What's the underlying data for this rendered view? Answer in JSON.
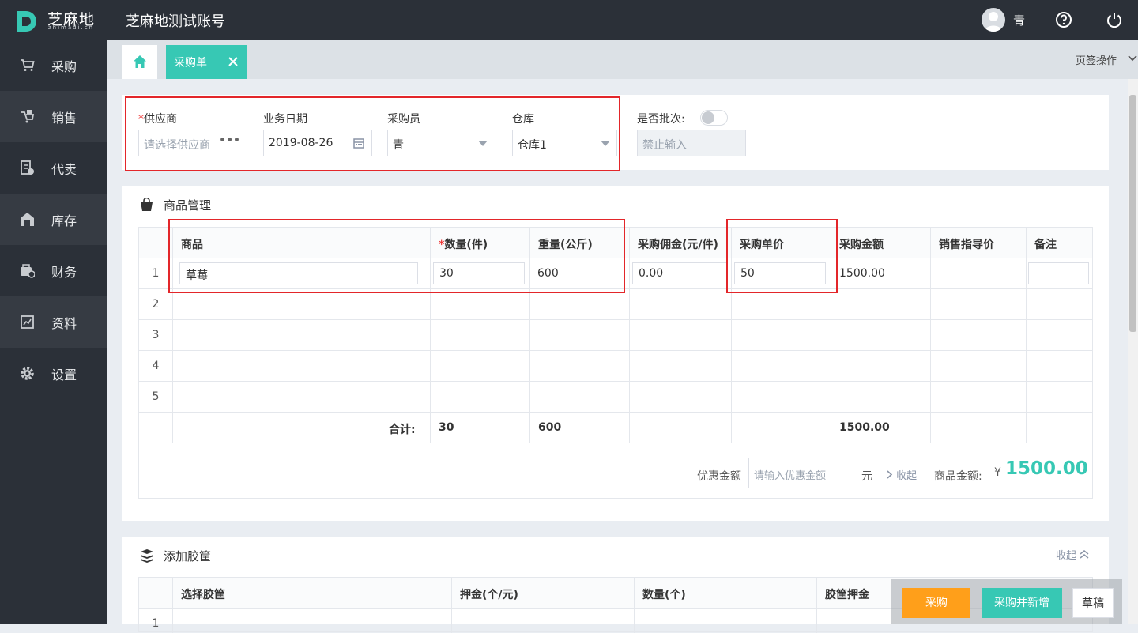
{
  "app": {
    "logo_text": "芝麻地",
    "logo_sub": "zhimadi.cn",
    "account": "芝麻地测试账号"
  },
  "user": {
    "name": "青"
  },
  "sidebar": {
    "items": [
      {
        "label": "采购",
        "icon": "cart-icon"
      },
      {
        "label": "销售",
        "icon": "sales-icon"
      },
      {
        "label": "代卖",
        "icon": "consign-icon"
      },
      {
        "label": "库存",
        "icon": "warehouse-icon"
      },
      {
        "label": "财务",
        "icon": "finance-icon"
      },
      {
        "label": "资料",
        "icon": "data-icon"
      },
      {
        "label": "设置",
        "icon": "gear-icon"
      }
    ]
  },
  "tabs": {
    "active_label": "采购单",
    "ops_label": "页签操作"
  },
  "form": {
    "supplier_label": "供应商",
    "supplier_placeholder": "请选择供应商",
    "date_label": "业务日期",
    "date_value": "2019-08-26",
    "buyer_label": "采购员",
    "buyer_value": "青",
    "warehouse_label": "仓库",
    "warehouse_value": "仓库1",
    "batch_label": "是否批次:",
    "batch_input": "禁止输入",
    "batch_on": false
  },
  "goods": {
    "title": "商品管理",
    "columns": [
      "商品",
      "数量(件)",
      "重量(公斤)",
      "采购佣金(元/件)",
      "采购单价",
      "采购金额",
      "销售指导价",
      "备注"
    ],
    "rows": [
      {
        "no": "1",
        "product": "草莓",
        "qty": "30",
        "weight": "600",
        "commission": "0.00",
        "price": "50",
        "amount": "1500.00",
        "guide": "",
        "remark": ""
      },
      {
        "no": "2"
      },
      {
        "no": "3"
      },
      {
        "no": "4"
      },
      {
        "no": "5"
      }
    ],
    "total_label": "合计:",
    "total_qty": "30",
    "total_weight": "600",
    "total_amount": "1500.00",
    "discount_label": "优惠金额",
    "discount_placeholder": "请输入优惠金额",
    "discount_unit": "元",
    "collapse_label": "收起",
    "goods_amount_label": "商品金额:",
    "goods_amount_symbol": "¥",
    "goods_amount_value": "1500.00"
  },
  "crates": {
    "title": "添加胶筐",
    "collapse_label": "收起",
    "columns": [
      "选择胶筐",
      "押金(个/元)",
      "数量(个)",
      "胶筐押金"
    ],
    "first_row_no": "1"
  },
  "actions": {
    "purchase": "采购",
    "purchase_new": "采购并新增",
    "draft": "草稿"
  },
  "colors": {
    "teal": "#37c8b4",
    "orange": "#ff9f1a",
    "dark": "#2b3038",
    "red": "#e3262a"
  }
}
